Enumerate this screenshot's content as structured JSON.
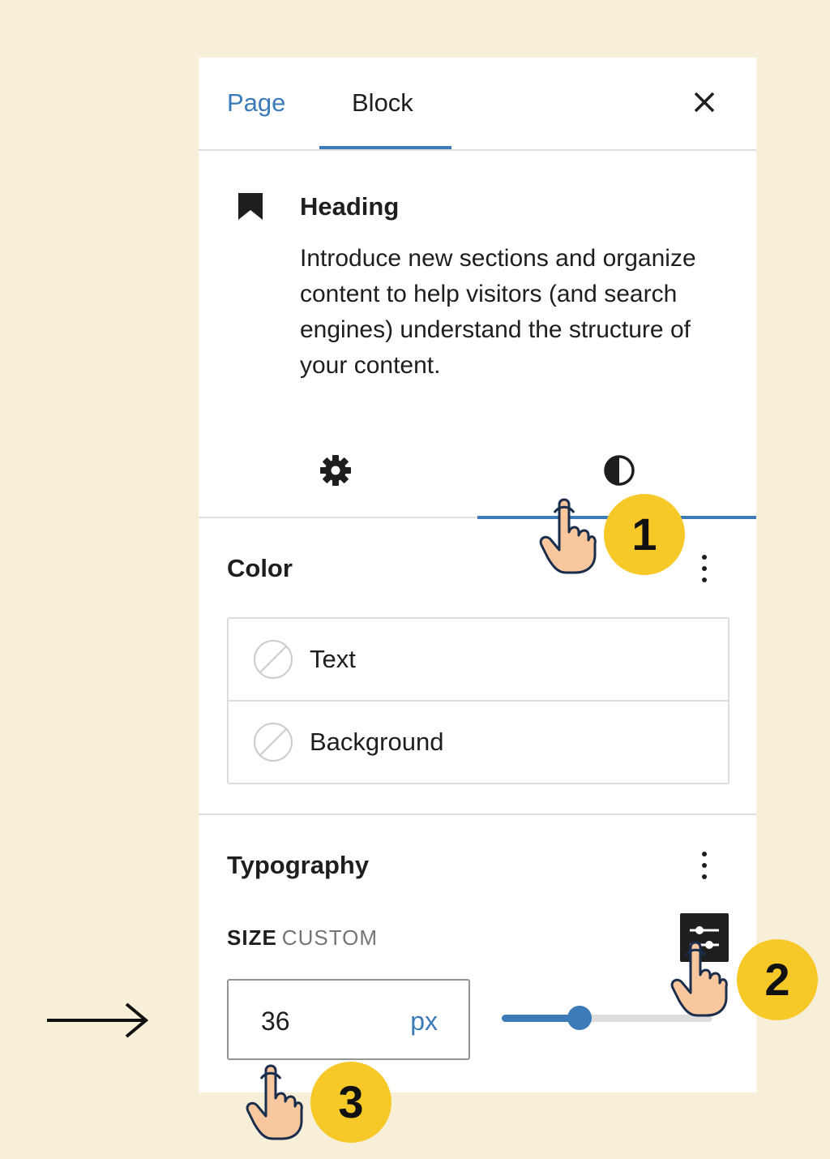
{
  "tabs": {
    "page": "Page",
    "block": "Block",
    "active": "Block"
  },
  "block": {
    "title": "Heading",
    "description": "Introduce new sections and organize content to help visitors (and search engines) understand the structure of your content."
  },
  "subtabs": {
    "active": "styles",
    "icons": [
      "gear-icon",
      "half-circle-icon"
    ]
  },
  "color_section": {
    "title": "Color",
    "items": [
      {
        "label": "Text"
      },
      {
        "label": "Background"
      }
    ]
  },
  "typography": {
    "title": "Typography",
    "size_label": "SIZE",
    "size_mode": "CUSTOM",
    "value": "36",
    "unit": "px",
    "slider_fraction": 0.37
  },
  "callouts": [
    "1",
    "2",
    "3"
  ],
  "colors": {
    "accent": "#3a7bb8",
    "badge": "#f6c928",
    "background": "#f8efd8"
  }
}
